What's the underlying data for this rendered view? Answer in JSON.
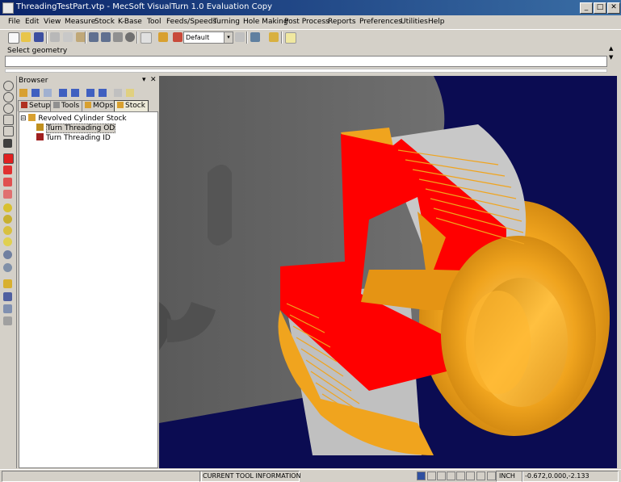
{
  "window": {
    "title": "ThreadingTestPart.vtp - MecSoft  VisualTurn 1.0 Evaluation Copy",
    "min": "_",
    "max": "□",
    "close": "✕"
  },
  "menu": [
    "File",
    "Edit",
    "View",
    "Measure",
    "Stock",
    "K-Base",
    "Tool",
    "Feeds/Speeds",
    "Turning",
    "Hole Making",
    "Post Process",
    "Reports",
    "Preferences",
    "Utilities",
    "Help"
  ],
  "toolbar": {
    "layer_combo": "Default",
    "combo_arrow": "▾"
  },
  "prompt": {
    "label": "Select geometry",
    "up": "▲",
    "down": "▼"
  },
  "browser": {
    "title": "Browser",
    "pin": "▾",
    "close": "✕",
    "tabs": [
      "Setup",
      "Tools",
      "MOps",
      "Stock"
    ],
    "active_tab": "Stock",
    "tree": [
      {
        "label": "Revolved Cylinder Stock",
        "expander": "⊟"
      },
      {
        "label": "Turn Threading OD"
      },
      {
        "label": "Turn Threading ID"
      }
    ]
  },
  "status": {
    "info": "CURRENT TOOL INFORMATION",
    "units": "INCH",
    "coords": "-0.672,0.000,-2.133"
  },
  "colors": {
    "viewport_bg": "#0b0c52",
    "stock_orange": "#f0a41e",
    "section_red": "#ff0000",
    "thread_gray": "#c8c8c8",
    "chuck_gray": "#606060"
  },
  "icons": [
    "app-icon",
    "new-icon",
    "open-icon",
    "save-icon",
    "cut-icon",
    "copy-icon",
    "paste-icon",
    "undo-icon",
    "redo-icon",
    "select-icon",
    "layer-icon",
    "shade-icon",
    "settings-icon",
    "help-icon"
  ]
}
